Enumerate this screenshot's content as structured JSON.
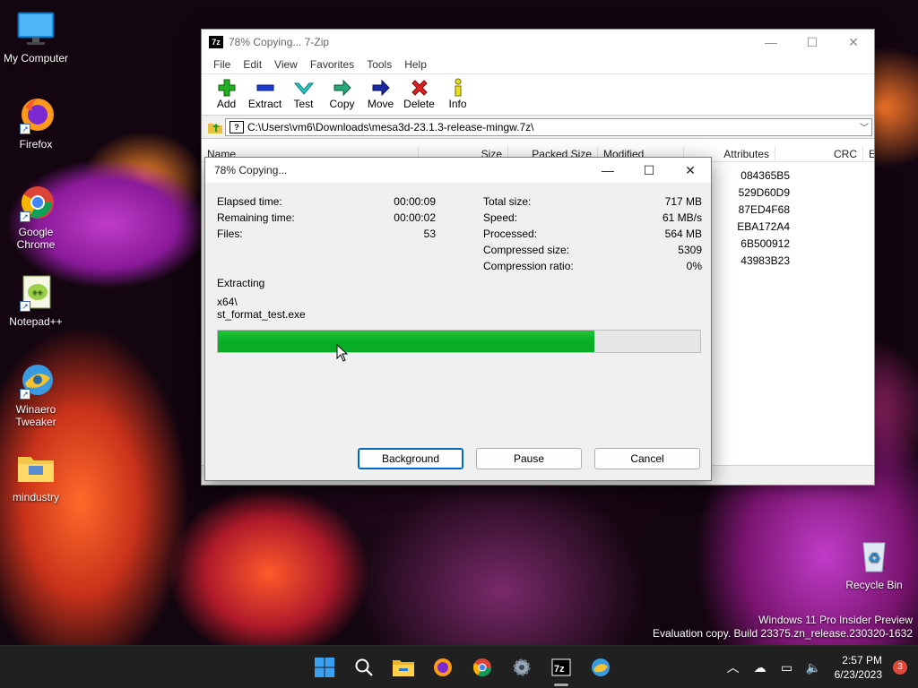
{
  "desktop": {
    "icons": [
      {
        "label": "My Computer"
      },
      {
        "label": "Firefox"
      },
      {
        "label": "Google Chrome"
      },
      {
        "label": "Notepad++"
      },
      {
        "label": "Winaero Tweaker"
      },
      {
        "label": "mindustry"
      },
      {
        "label": "Recycle Bin"
      }
    ],
    "watermark_line1": "Windows 11 Pro Insider Preview",
    "watermark_line2": "Evaluation copy. Build 23375.zn_release.230320-1632"
  },
  "main_window": {
    "title": "78% Copying... 7-Zip",
    "app_icon_text": "7z",
    "menu": [
      "File",
      "Edit",
      "View",
      "Favorites",
      "Tools",
      "Help"
    ],
    "toolbar": [
      "Add",
      "Extract",
      "Test",
      "Copy",
      "Move",
      "Delete",
      "Info"
    ],
    "address": "C:\\Users\\vm6\\Downloads\\mesa3d-23.1.3-release-mingw.7z\\",
    "columns": [
      "Name",
      "Size",
      "Packed Size",
      "Modified",
      "Attributes",
      "CRC",
      "Encrypte"
    ],
    "crc_values": [
      "084365B5",
      "529D60D9",
      "87ED4F68",
      "EBA172A4",
      "6B500912",
      "43983B23"
    ]
  },
  "dialog": {
    "title": "78% Copying...",
    "left_stats": [
      {
        "label": "Elapsed time:",
        "value": "00:00:09"
      },
      {
        "label": "Remaining time:",
        "value": "00:00:02"
      },
      {
        "label": "Files:",
        "value": "53"
      }
    ],
    "right_stats": [
      {
        "label": "Total size:",
        "value": "717 MB"
      },
      {
        "label": "Speed:",
        "value": "61 MB/s"
      },
      {
        "label": "Processed:",
        "value": "564 MB"
      },
      {
        "label": "Compressed size:",
        "value": "5309"
      },
      {
        "label": "Compression ratio:",
        "value": "0%"
      }
    ],
    "action": "Extracting",
    "path_line1": "x64\\",
    "path_line2": "st_format_test.exe",
    "progress_percent": 78,
    "buttons": {
      "background": "Background",
      "pause": "Pause",
      "cancel": "Cancel"
    }
  },
  "taskbar": {
    "clock_time": "2:57 PM",
    "clock_date": "6/23/2023",
    "notification_count": "3",
    "pinned": [
      "start",
      "search",
      "file-explorer",
      "firefox",
      "chrome",
      "settings",
      "7zip",
      "winaero"
    ]
  },
  "colors": {
    "progress_fill": "#06b025",
    "accent": "#0067c0"
  }
}
